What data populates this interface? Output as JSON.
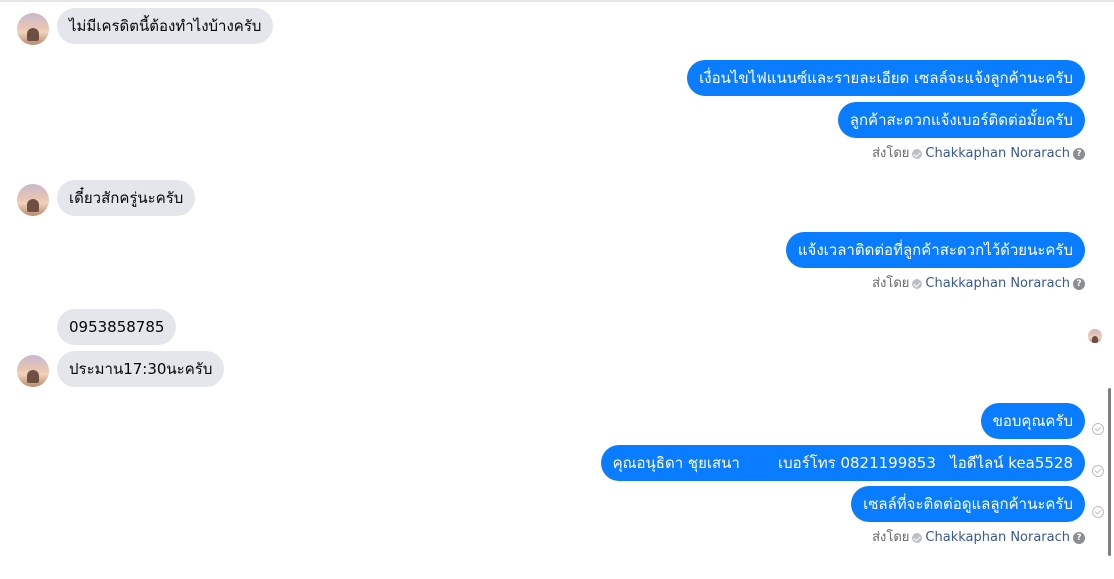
{
  "messages": {
    "in_1": "ไม่มีเครดิตนี้ต้องทำไงบ้างครับ",
    "out_1": "เงื่อนไขไฟแนนซ์และรายละเอียด เซลล์จะแจ้งลูกค้านะครับ",
    "out_2": "ลูกค้าสะดวกแจ้งเบอร์ติดต่อมั้ยครับ",
    "in_2": "เดี๋ยวสักครู่นะครับ",
    "out_3": "แจ้งเวลาติดต่อที่ลูกค้าสะดวกไว้ด้วยนะครับ",
    "in_3": "0953858785",
    "in_4": "ประมาน17:30นะครับ",
    "out_4": "ขอบคุณครับ",
    "out_5": "คุณอนุธิดา ชุยเสนา        เบอร์โทร 0821199853   ไอดีไลน์ kea5528",
    "out_6": "เซลล์ที่จะติดต่อดูแลลูกค้านะครับ"
  },
  "sent_by": {
    "label": "ส่งโดย",
    "name": "Chakkaphan Norarach",
    "help": "?"
  }
}
